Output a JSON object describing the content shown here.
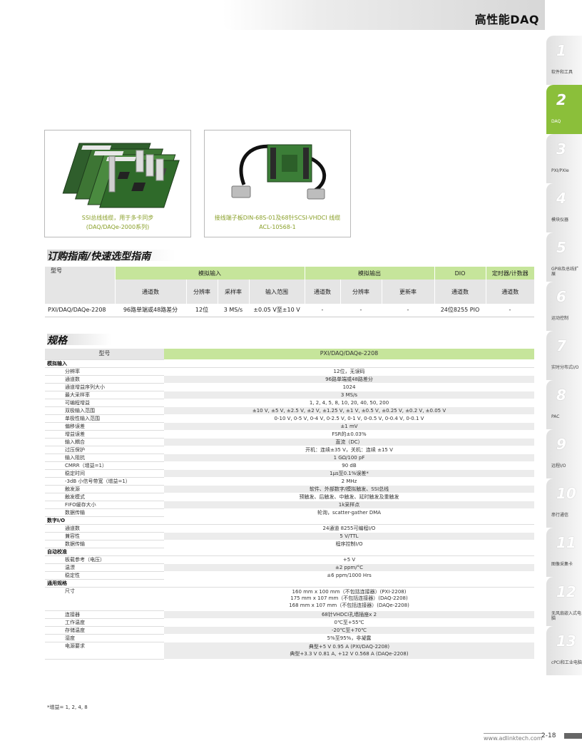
{
  "header": {
    "title": "高性能DAQ"
  },
  "sidetabs": [
    {
      "num": "1",
      "label": "软件和工具",
      "active": false
    },
    {
      "num": "2",
      "label": "DAQ",
      "active": true
    },
    {
      "num": "3",
      "label": "PXI/PXIe",
      "active": false
    },
    {
      "num": "4",
      "label": "模块仪器",
      "active": false
    },
    {
      "num": "5",
      "label": "GPIB及总线扩展",
      "active": false
    },
    {
      "num": "6",
      "label": "运动控制",
      "active": false
    },
    {
      "num": "7",
      "label": "实时分布式I/O",
      "active": false
    },
    {
      "num": "8",
      "label": "PAC",
      "active": false
    },
    {
      "num": "9",
      "label": "远程I/O",
      "active": false
    },
    {
      "num": "10",
      "label": "串行通信",
      "active": false
    },
    {
      "num": "11",
      "label": "图像采集卡",
      "active": false
    },
    {
      "num": "12",
      "label": "无风扇嵌入式电脑",
      "active": false
    },
    {
      "num": "13",
      "label": "cPCI和工业电脑",
      "active": false
    }
  ],
  "products": {
    "left": {
      "caption1": "SSI总线线缆，用于多卡同步",
      "caption2": "(DAQ/DAQe-2000系列)"
    },
    "right": {
      "caption1": "接线端子板DIN-68S-01及68针SCSI-VHDCI 线缆",
      "caption2": "ACL-10568-1"
    }
  },
  "ordering": {
    "heading": "订购指南/快速选型指南",
    "model_header": "型号",
    "groups": [
      "模拟输入",
      "模拟输出",
      "DIO",
      "定时器/计数器"
    ],
    "subheaders": [
      "通道数",
      "分辨率",
      "采样率",
      "输入范围",
      "通道数",
      "分辨率",
      "更新率",
      "通道数",
      "通道数"
    ],
    "row": [
      "PXI/DAQ/DAQe-2208",
      "96路单端或48路差分",
      "12位",
      "3 MS/s",
      "±0.05 V至±10 V",
      "-",
      "-",
      "-",
      "24位8255 PIO",
      "-"
    ]
  },
  "spec": {
    "heading": "规格",
    "model_header": "型号",
    "model_value": "PXI/DAQ/DAQe-2208",
    "sections": [
      {
        "title": "模拟输入",
        "rows": [
          [
            "分辨率",
            "12位，无误码"
          ],
          [
            "通道数",
            "96路单端或48路差分"
          ],
          [
            "通道增益序列大小",
            "1024"
          ],
          [
            "最大采样率",
            "3 MS/s"
          ],
          [
            "可编程增益",
            "1, 2, 4, 5, 8, 10, 20, 40, 50, 200"
          ],
          [
            "双极输入范围",
            "±10 V, ±5 V, ±2.5 V, ±2 V, ±1.25 V, ±1 V, ±0.5 V, ±0.25 V, ±0.2 V, ±0.05 V"
          ],
          [
            "单极性输入范围",
            "0-10 V, 0-5 V, 0-4 V, 0-2.5 V, 0-1 V, 0-0.5 V, 0-0.4 V, 0-0.1 V"
          ],
          [
            "偏移误差",
            "±1 mV"
          ],
          [
            "增益误差",
            "FSR的±0.03%"
          ],
          [
            "输入耦合",
            "直流（DC）"
          ],
          [
            "过压保护",
            "开机：连续±35 V，关机：连续 ±15 V"
          ],
          [
            "输入阻抗",
            "1 GΩ/100 pF"
          ],
          [
            "CMRR（增益=1）",
            "90 dB"
          ],
          [
            "稳定时间",
            "1μs至0.1%误差*"
          ],
          [
            "-3dB 小信号带宽（增益=1）",
            "2 MHz"
          ],
          [
            "触发源",
            "软件、外部数字/模拟触发、SSI总线"
          ],
          [
            "触发模式",
            "预触发、后触发、中触发、延时触发及重触发"
          ],
          [
            "FIFO缓存大小",
            "1k采样点"
          ],
          [
            "数据传输",
            "轮询，scatter-gather DMA"
          ]
        ]
      },
      {
        "title": "数字I/O",
        "rows": [
          [
            "通道数",
            "24通道 8255可编程I/O"
          ],
          [
            "兼容性",
            "5 V/TTL"
          ],
          [
            "数据传输",
            "程序控制I/O"
          ]
        ]
      },
      {
        "title": "自动校准",
        "rows": [
          [
            "板载参考（电压）",
            "+5 V"
          ],
          [
            "温漂",
            "±2 ppm/°C"
          ],
          [
            "稳定性",
            "±6 ppm/1000 Hrs"
          ]
        ]
      },
      {
        "title": "通用规格",
        "rows": [
          [
            "尺寸",
            "160 mm x 100 mm（不包括连接器）(PXI-2208)",
            "175 mm x 107 mm（不包括连接器）(DAQ-2208)",
            "168 mm x 107 mm（不包括连接器）(DAQe-2208)"
          ],
          [
            "连接器",
            "68针VHDCI孔墙插座x 2"
          ],
          [
            "工作温度",
            "0℃至+55℃"
          ],
          [
            "存储温度",
            "-20℃至+70℃"
          ],
          [
            "湿度",
            "5%至95%，非凝露"
          ],
          [
            "电源要求",
            "典型+5 V 0.95 A (PXI/DAQ-2208)",
            "典型+3.3 V 0.81 A, +12 V 0.568 A (DAQe-2208)"
          ]
        ]
      }
    ],
    "footnote": "*增益= 1, 2, 4, 8"
  },
  "footer": {
    "url": "www.adlinktech.com",
    "page": "2-18"
  }
}
